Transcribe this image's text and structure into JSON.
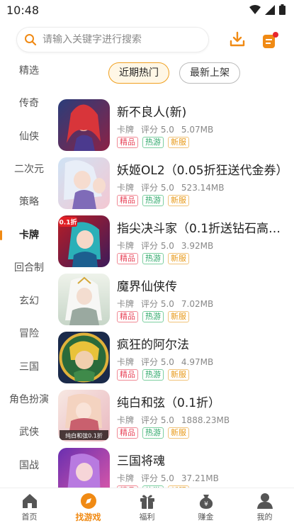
{
  "status": {
    "time": "10:48"
  },
  "search": {
    "placeholder": "请输入关键字进行搜索"
  },
  "sidebar": {
    "items": [
      {
        "label": "精选"
      },
      {
        "label": "传奇"
      },
      {
        "label": "仙侠"
      },
      {
        "label": "二次元"
      },
      {
        "label": "策略"
      },
      {
        "label": "卡牌",
        "active": true
      },
      {
        "label": "回合制"
      },
      {
        "label": "玄幻"
      },
      {
        "label": "冒险"
      },
      {
        "label": "三国"
      },
      {
        "label": "角色扮演"
      },
      {
        "label": "武侠"
      },
      {
        "label": "国战"
      }
    ]
  },
  "tabs": [
    {
      "label": "近期热门",
      "active": true
    },
    {
      "label": "最新上架"
    }
  ],
  "games": [
    {
      "name": "新不良人(新)",
      "type": "卡牌",
      "rating": "评分 5.0",
      "size": "5.07MB",
      "tags": [
        "精品",
        "热游",
        "新服"
      ]
    },
    {
      "name": "妖姬OL2（0.05折狂送代金券）",
      "type": "卡牌",
      "rating": "评分 5.0",
      "size": "523.14MB",
      "tags": [
        "精品",
        "热游",
        "新服"
      ]
    },
    {
      "name": "指尖决斗家（0.1折送钻石高…",
      "type": "卡牌",
      "rating": "评分 5.0",
      "size": "3.92MB",
      "tags": [
        "精品",
        "热游",
        "新服"
      ]
    },
    {
      "name": "魔界仙侠传",
      "type": "卡牌",
      "rating": "评分 5.0",
      "size": "7.02MB",
      "tags": [
        "精品",
        "热游",
        "新服"
      ]
    },
    {
      "name": " 疯狂的阿尔法",
      "type": "卡牌",
      "rating": "评分 5.0",
      "size": "4.97MB",
      "tags": [
        "精品",
        "热游",
        "新服"
      ]
    },
    {
      "name": "纯白和弦（0.1折）",
      "type": "卡牌",
      "rating": "评分 5.0",
      "size": "1888.23MB",
      "tags": [
        "精品",
        "热游",
        "新服"
      ]
    },
    {
      "name": "三国将魂",
      "type": "卡牌",
      "rating": "评分 5.0",
      "size": "37.21MB",
      "tags": [
        "精品",
        "热游",
        "新服"
      ]
    }
  ],
  "thumb_badges": {
    "g3": "0.1折",
    "g6": "纯白和弦0.1折"
  },
  "bottom_nav": [
    {
      "label": "首页",
      "icon": "home-icon"
    },
    {
      "label": "找游戏",
      "icon": "compass-icon",
      "active": true
    },
    {
      "label": "福利",
      "icon": "gift-icon"
    },
    {
      "label": "赚金",
      "icon": "coin-bag-icon"
    },
    {
      "label": "我的",
      "icon": "user-icon"
    }
  ],
  "colors": {
    "accent": "#f08a14",
    "tag_red": "#e8455a",
    "tag_green": "#2ea86a",
    "tag_orange": "#e89a1a"
  }
}
